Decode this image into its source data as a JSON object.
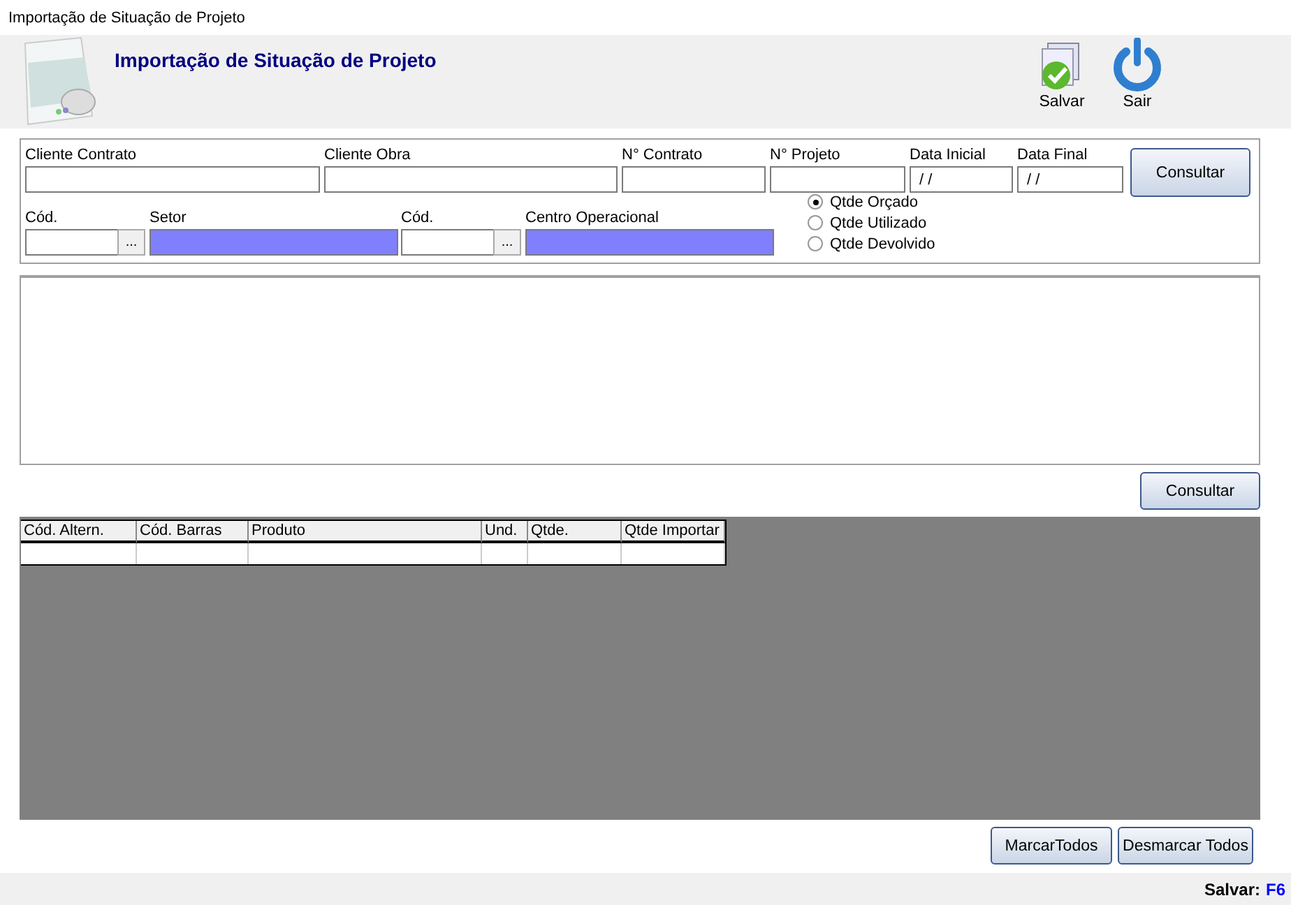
{
  "window": {
    "title": "Importação de Situação de Projeto"
  },
  "header": {
    "title": "Importação de Situação de Projeto",
    "actions": [
      {
        "kind": "save",
        "label": "Salvar"
      },
      {
        "kind": "exit",
        "label": "Sair"
      }
    ]
  },
  "filters": {
    "fields": [
      {
        "label": "Cliente Contrato"
      },
      {
        "label": "Cliente Obra"
      },
      {
        "label": "N° Contrato"
      },
      {
        "label": "N° Projeto"
      },
      {
        "label": "Data Inicial",
        "value": "/ /"
      },
      {
        "label": "Data Final",
        "value": "/ /"
      }
    ],
    "button": "Consultar",
    "lookups": [
      {
        "code_label": "Cód.",
        "browse": "...",
        "name_label": "Setor"
      },
      {
        "code_label": "Cód.",
        "browse": "...",
        "name_label": "Centro Operacional"
      }
    ],
    "options": [
      {
        "label": "Qtde Orçado",
        "selected": true
      },
      {
        "label": "Qtde Utilizado",
        "selected": false
      },
      {
        "label": "Qtde Devolvido",
        "selected": false
      }
    ]
  },
  "consult_button": "Consultar",
  "grid": {
    "columns": [
      "Cód. Altern.",
      "Cód. Barras",
      "Produto",
      "Und.",
      "Qtde.",
      "Qtde Importar"
    ]
  },
  "buttons": [
    "MarcarTodos",
    "Desmarcar Todos"
  ],
  "status_bar": {
    "label": "Salvar:",
    "key": "F6"
  }
}
